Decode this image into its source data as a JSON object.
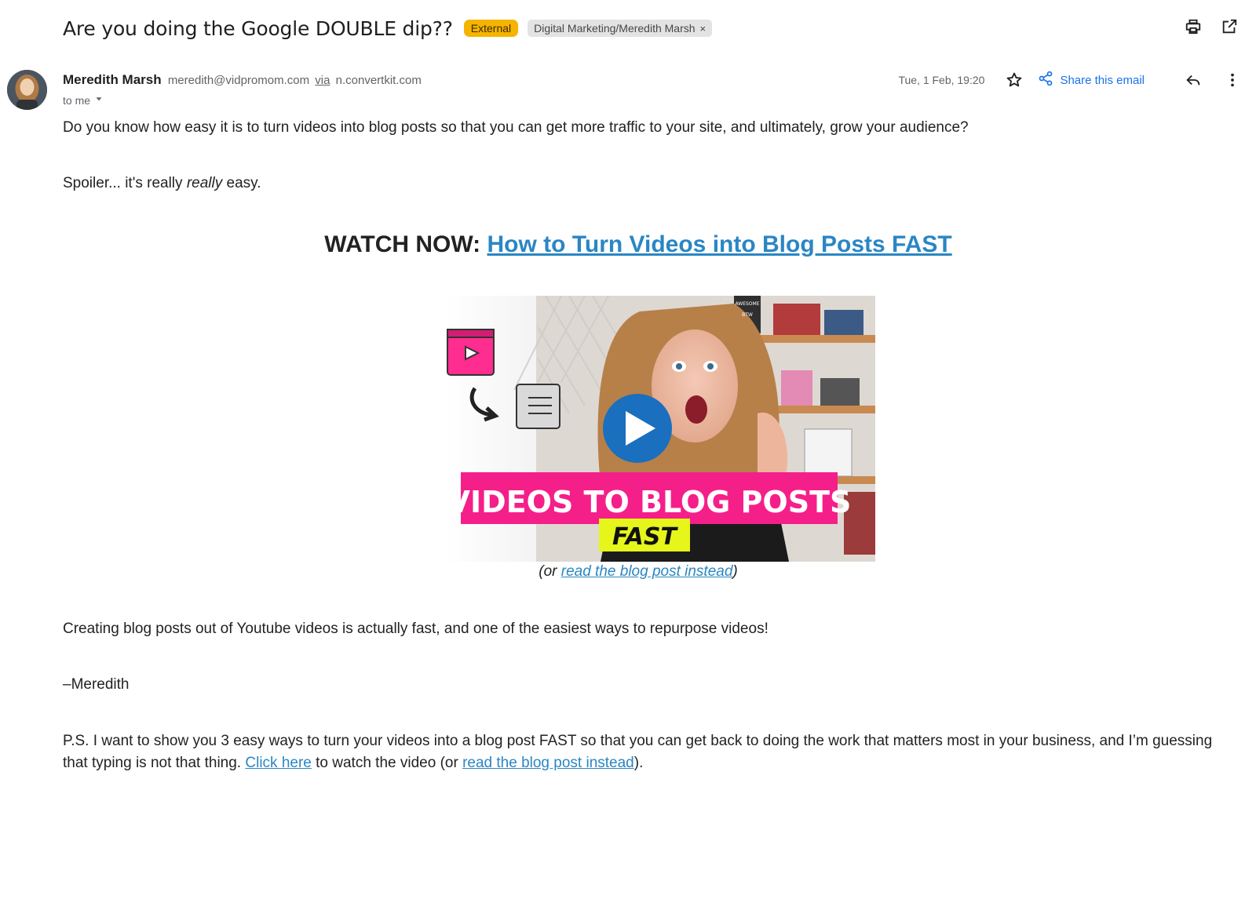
{
  "email": {
    "subject": "Are you doing the Google DOUBLE dip??",
    "chip_external": "External",
    "chip_label": "Digital Marketing/Meredith Marsh",
    "chip_close": "×",
    "sender_name": "Meredith Marsh",
    "sender_email": "meredith@vidpromom.com",
    "sender_via": "via",
    "sender_domain": "n.convertkit.com",
    "to_me": "to me",
    "date": "Tue, 1 Feb, 19:20",
    "share_label": "Share this email"
  },
  "body": {
    "p1": "Do you know how easy it is to turn videos into blog posts so that you can get more traffic to your site, and ultimately, grow your audience?",
    "p2_prefix": "Spoiler... it's really ",
    "p2_emph": "really",
    "p2_suffix": " easy.",
    "watch_prefix": "WATCH NOW: ",
    "watch_link": "How to Turn Videos into Blog Posts FAST",
    "thumb_banner": "VIDEOS TO BLOG POSTS",
    "thumb_sub": "FAST",
    "thumb_sign_top": "AWESOME",
    "thumb_sign_bottom": "BTW",
    "caption_prefix": "(or ",
    "caption_link": "read the blog post instead",
    "caption_suffix": ")",
    "p3": "Creating blog posts out of Youtube videos is actually fast, and one of the easiest ways to repurpose videos!",
    "signoff": "–Meredith",
    "ps_text1": "P.S. I want to show you 3 easy ways to turn your videos into a blog post FAST so that you can get back to doing the work that matters most in your business, and I’m guessing that typing is not that thing. ",
    "ps_link1": "Click here",
    "ps_text2": " to watch the video (or ",
    "ps_link2": "read the blog post instead",
    "ps_text3": ")."
  },
  "colors": {
    "link": "#2a86c4",
    "external_chip": "#f5b400",
    "banner_pink": "#f51f8a",
    "banner_yellow": "#e6f51a",
    "play_blue": "#1a6fbf"
  },
  "icons": [
    "print-icon",
    "open-in-new-window-icon",
    "star-icon",
    "share-icon",
    "reply-icon",
    "more-vert-icon",
    "chevron-down-icon",
    "play-icon"
  ]
}
